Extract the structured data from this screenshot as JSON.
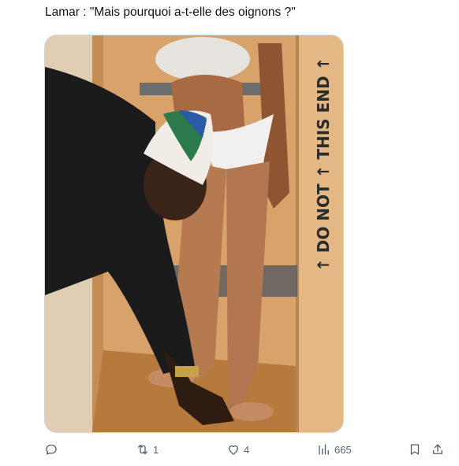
{
  "tweet": {
    "text": "Lamar : \"Mais pourquoi a-t-elle des oignons ?\""
  },
  "media": {
    "crate_text": "↑ DO NOT ↑ THIS END ↑"
  },
  "actions": {
    "reply": {
      "icon": "reply-icon",
      "count": ""
    },
    "retweet": {
      "icon": "retweet-icon",
      "count": "1"
    },
    "like": {
      "icon": "heart-icon",
      "count": "4"
    },
    "views": {
      "icon": "views-icon",
      "count": "665"
    },
    "bookmark": {
      "icon": "bookmark-icon"
    },
    "share": {
      "icon": "share-icon"
    }
  }
}
